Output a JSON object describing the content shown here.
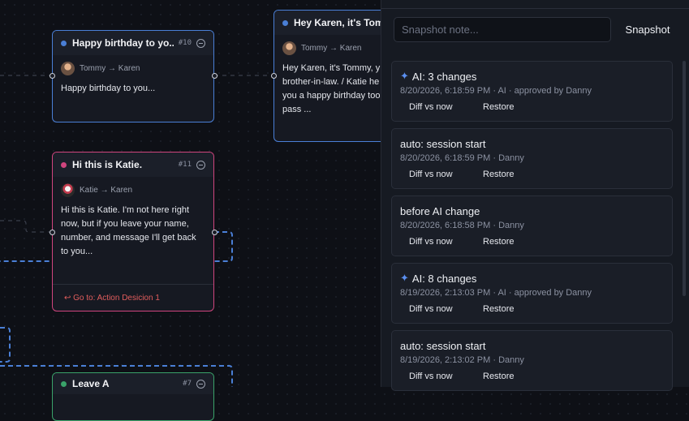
{
  "nodes": {
    "birthday": {
      "title": "Happy birthday to yo...",
      "num": "#10",
      "from": "Tommy",
      "to": "Karen",
      "arrow": "→",
      "body": "Happy birthday to you..."
    },
    "hey": {
      "title": "Hey Karen, it's Tomm...",
      "from": "Tommy",
      "to": "Karen",
      "arrow": "→",
      "body_lines": [
        "Hey Karen, it's Tommy, y",
        "brother-in-law. / Katie he",
        "you a happy birthday too",
        "pass ..."
      ]
    },
    "katie": {
      "title": "Hi this is Katie.",
      "num": "#11",
      "from": "Katie",
      "to": "Karen",
      "arrow": "→",
      "body": "Hi this is Katie. I'm not here right now, but if you leave your name, number, and message I'll get back to you...",
      "footer": "↩ Go to: Action Desicion 1"
    },
    "leave": {
      "title": "Leave A",
      "num": "#7"
    }
  },
  "snapshot": {
    "placeholder": "Snapshot note...",
    "button": "Snapshot",
    "diff_label": "Diff vs now",
    "restore_label": "Restore",
    "items": [
      {
        "ai": true,
        "title": "AI: 3 changes",
        "sub": "8/20/2026, 6:18:59 PM · AI · approved by Danny"
      },
      {
        "ai": false,
        "title": "auto: session start",
        "sub": "8/20/2026, 6:18:59 PM · Danny"
      },
      {
        "ai": false,
        "title": "before AI change",
        "sub": "8/20/2026, 6:18:58 PM · Danny"
      },
      {
        "ai": true,
        "title": "AI: 8 changes",
        "sub": "8/19/2026, 2:13:03 PM · AI · approved by Danny"
      },
      {
        "ai": false,
        "title": "auto: session start",
        "sub": "8/19/2026, 2:13:02 PM · Danny"
      }
    ]
  },
  "icons": {
    "ai_marker": "sparkle-icon",
    "node_collapse": "minus-circle-icon"
  },
  "colors": {
    "accent_blue": "#4a7fd6",
    "accent_pink": "#d0457e",
    "accent_green": "#3aa36a",
    "goto_red": "#e25d5d"
  }
}
